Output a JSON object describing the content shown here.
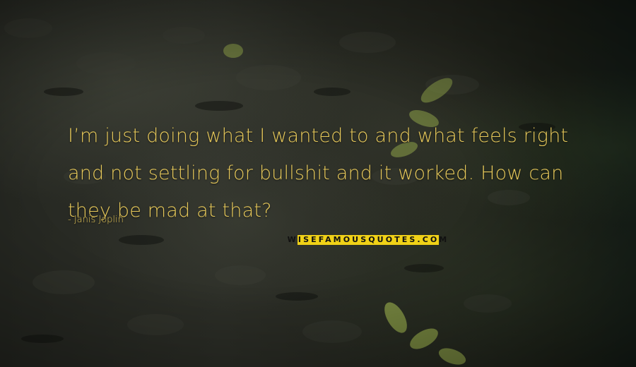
{
  "quote": {
    "line1": "I’m just doing what I wanted to and what feels right",
    "line2": "and not settling for bullshit and it worked. How can",
    "line3": "they be mad at that?"
  },
  "author": "- Janis Joplin",
  "watermark": "WISEFAMOUSQUOTES.COM",
  "colors": {
    "quote_text": "#e6c85a",
    "watermark_bg": "#f0d117",
    "watermark_text": "#111111"
  }
}
